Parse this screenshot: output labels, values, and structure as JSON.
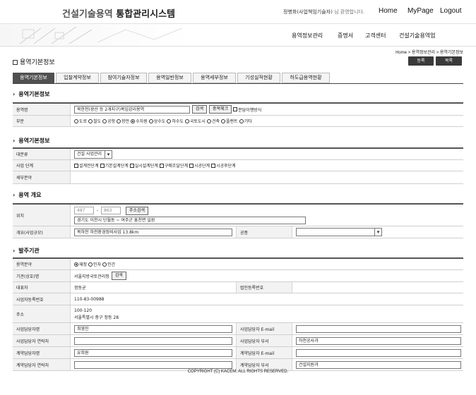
{
  "header": {
    "brand_part1": "건설기술용역",
    "brand_part2": "통합관리시스템",
    "welcome_user": "정병화(사업책임기술자)",
    "welcome_text": "님 환영합니다.",
    "links": [
      "Home",
      "MyPage",
      "Logout"
    ]
  },
  "menu": [
    "용역정보관리",
    "증명서",
    "고객센터",
    "건설기술용역업"
  ],
  "breadcrumb": "Home > 용역정보관리 > 용역기본정보",
  "page": {
    "title": "용역기본정보",
    "register_label": "등록",
    "list_label": "목록"
  },
  "tabs": [
    "용역기본정보",
    "입찰계약정보",
    "참여기술자정보",
    "용역일반정보",
    "용역세부정보",
    "기성실적현황",
    "하도급용역현황"
  ],
  "sections": {
    "basic": {
      "title": "용역기본정보",
      "name_label": "용역명",
      "name_value": "북한천(광산 등 2개지구)복입강리용역",
      "search_label": "검색",
      "dup_check_label": "중복체크",
      "joint_label": "분담이행방식",
      "sector_label": "부문",
      "sectors": [
        "도로",
        "철도",
        "공항",
        "항만",
        "수자원",
        "상수도",
        "하수도",
        "국토도시",
        "건축",
        "플랜트",
        "기타"
      ],
      "sector_selected": "수자원"
    },
    "service": {
      "title": "용역기본정보",
      "class_label": "대분류",
      "class_value": "건설 사업관리",
      "stage_label": "사업 단계",
      "stages": [
        "설계전단계",
        "기본설계단계",
        "실시설계단계",
        "구매조달단계",
        "시공단계",
        "시공후단계"
      ],
      "detail_label": "세부분야",
      "detail_value": ""
    },
    "overview": {
      "title": "용역 개요",
      "location_label": "위치",
      "zip1": "487",
      "zip2": "863",
      "address_button": "주소검색",
      "address_value": "경기도 이천시 단월동 ~ 여주군 흥천면 일원",
      "summary_label": "개요(사업규모)",
      "summary_value": "복하천 하천환경정비사업 13.8km",
      "method_label": "공종",
      "method_value": ""
    },
    "client": {
      "title": "발주기관",
      "field_label": "용역분야",
      "fields": [
        "재정",
        "민자",
        "민간"
      ],
      "field_selected": "재정",
      "agency_label": "기관(상호)명",
      "agency_value": "서울지방국토관리청",
      "agency_search": "검색",
      "rep_label": "대표자",
      "rep_value": "정동균",
      "corp_reg_label": "법인등록번호",
      "corp_reg_value": "",
      "biz_no_label": "사업자등록번호",
      "biz_no_value": "110-83-00988",
      "addr_label": "주소",
      "addr_zip": "100-120",
      "addr_value": "서울특별시 중구 정동 28",
      "biz_person_label": "사업담당자명",
      "biz_person_value": "최영진",
      "biz_email_label": "사업담당자 E-mail",
      "biz_email_value": "",
      "biz_phone_label": "사업담당자 연락처",
      "biz_phone_value": "",
      "biz_dept_label": "사업담당자 부서",
      "biz_dept_value": "하천공사과",
      "ct_person_label": "계약담당자명",
      "ct_person_value": "유희원",
      "ct_email_label": "계약담당자 E-mail",
      "ct_email_value": "",
      "ct_phone_label": "계약담당자 연락처",
      "ct_phone_value": "",
      "ct_dept_label": "계약담당자 부서",
      "ct_dept_value": "건설지원과"
    }
  },
  "footer": "COPYRIGHT (C) KACEM,  ALL RIGHTS RESERVED."
}
